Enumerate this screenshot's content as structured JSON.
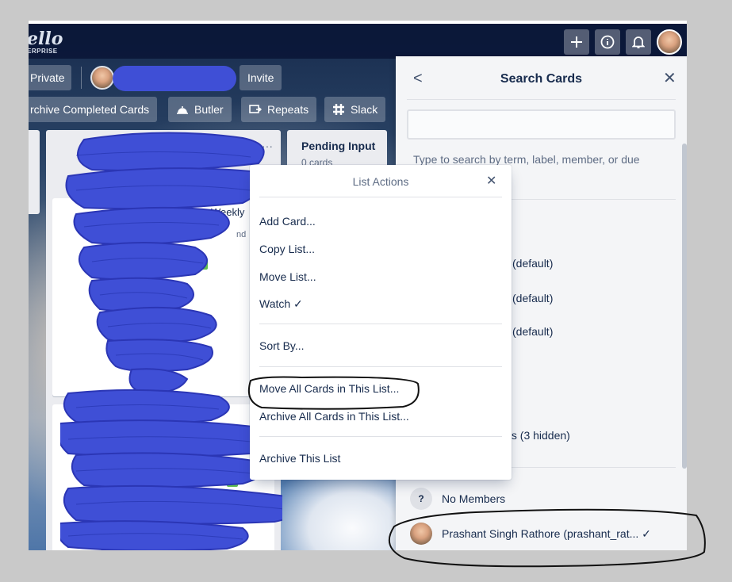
{
  "header": {
    "logo_text": "ello",
    "logo_sub": "ERPRISE",
    "plus_icon": "plus-icon",
    "info_icon": "info-icon",
    "bell_icon": "bell-icon"
  },
  "board_bar": {
    "visibility": "Private",
    "invite": "Invite",
    "archive_completed": "rchive Completed Cards",
    "butler": "Butler",
    "repeats": "Repeats",
    "slack": "Slack"
  },
  "lists": {
    "pending_title": "Pending Input",
    "pending_count": "0 cards",
    "partial_weekly": "Weekly",
    "partial_nd": "nd",
    "list_more": "···"
  },
  "list_actions": {
    "title": "List Actions",
    "items": [
      "Add Card...",
      "Copy List...",
      "Move List...",
      "Watch ✓",
      "Sort By...",
      "Move All Cards in This List...",
      "Archive All Cards in This List...",
      "Archive This List"
    ]
  },
  "search_panel": {
    "title": "Search Cards",
    "back": "<",
    "close": "✕",
    "input_value": "",
    "hint": "Type to search by term, label, member, or due",
    "labels": [
      "(default)",
      "(default)",
      "(default)"
    ],
    "hidden_labels": "els (3 hidden)",
    "no_members_icon": "?",
    "no_members": "No Members",
    "member": "Prashant Singh Rathore (prashant_rat... ✓"
  },
  "colors": {
    "accent_green": "#61bd4f",
    "header_bg": "#091434",
    "panel_bg": "#f4f5f7",
    "scribble": "#3f4fd6"
  }
}
